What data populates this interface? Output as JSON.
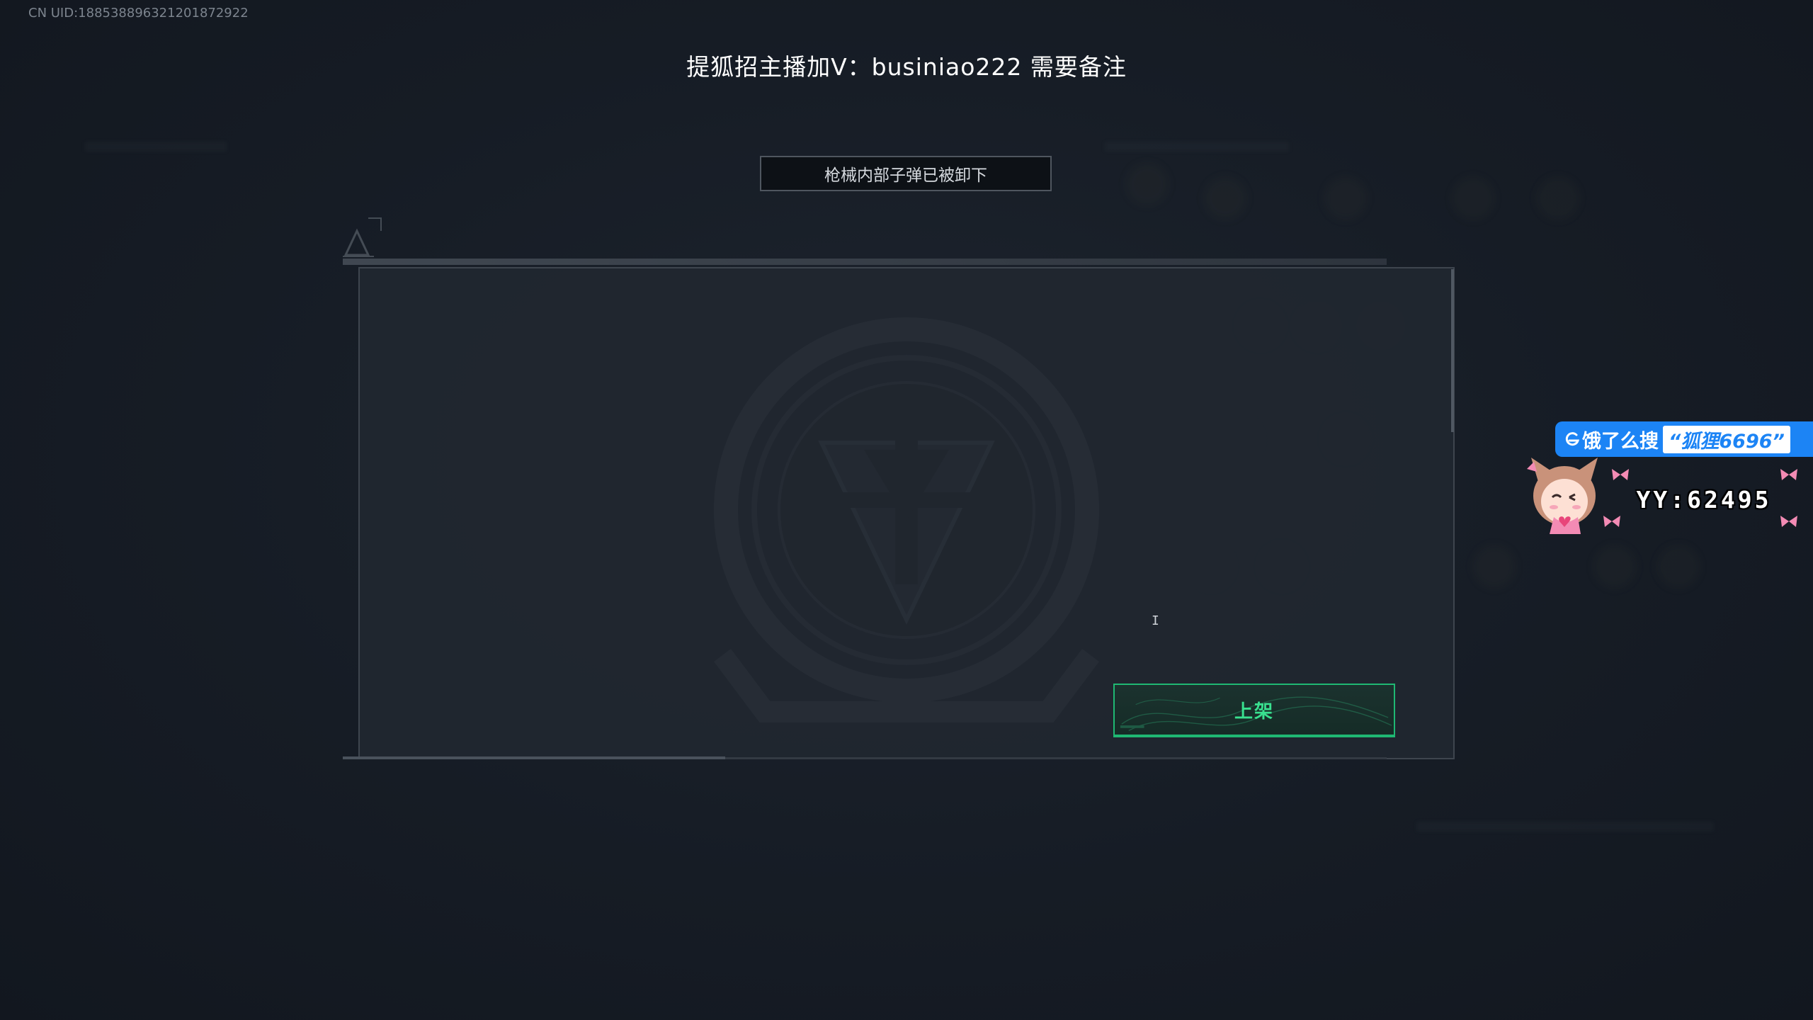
{
  "hud": {
    "uid": "CN UID:188538896321201872922"
  },
  "stream_banner": "提狐招主播加V：businiao222 需要备注",
  "notice": "枪械内部子弹已被卸下",
  "dialog": {
    "list_button_label": "上架"
  },
  "overlay": {
    "promo_prefix": "饿了么搜",
    "promo_query": "“狐狸6696”",
    "yy_label": "YY:62495",
    "accent_color": "#1c84f5"
  },
  "colors": {
    "button_border": "#1fb873",
    "button_text": "#39e08f",
    "background": "#161c25"
  }
}
